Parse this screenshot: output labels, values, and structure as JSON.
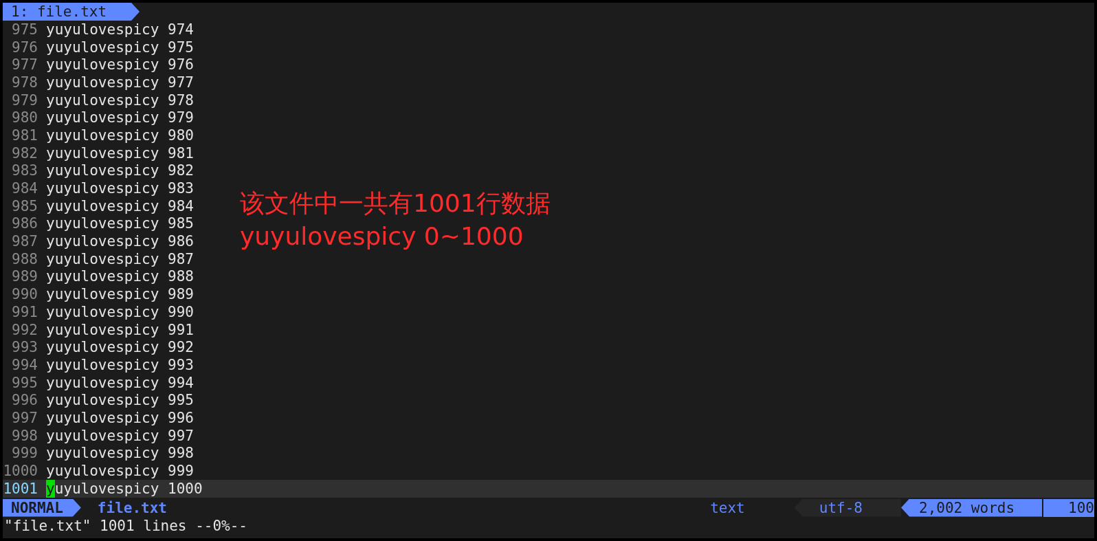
{
  "tabline": {
    "tabs": [
      {
        "label": "1: file.txt",
        "selected": true
      }
    ]
  },
  "lines": [
    {
      "number": "975",
      "text": "yuyulovespicy 974",
      "current": false
    },
    {
      "number": "976",
      "text": "yuyulovespicy 975",
      "current": false
    },
    {
      "number": "977",
      "text": "yuyulovespicy 976",
      "current": false
    },
    {
      "number": "978",
      "text": "yuyulovespicy 977",
      "current": false
    },
    {
      "number": "979",
      "text": "yuyulovespicy 978",
      "current": false
    },
    {
      "number": "980",
      "text": "yuyulovespicy 979",
      "current": false
    },
    {
      "number": "981",
      "text": "yuyulovespicy 980",
      "current": false
    },
    {
      "number": "982",
      "text": "yuyulovespicy 981",
      "current": false
    },
    {
      "number": "983",
      "text": "yuyulovespicy 982",
      "current": false
    },
    {
      "number": "984",
      "text": "yuyulovespicy 983",
      "current": false
    },
    {
      "number": "985",
      "text": "yuyulovespicy 984",
      "current": false
    },
    {
      "number": "986",
      "text": "yuyulovespicy 985",
      "current": false
    },
    {
      "number": "987",
      "text": "yuyulovespicy 986",
      "current": false
    },
    {
      "number": "988",
      "text": "yuyulovespicy 987",
      "current": false
    },
    {
      "number": "989",
      "text": "yuyulovespicy 988",
      "current": false
    },
    {
      "number": "990",
      "text": "yuyulovespicy 989",
      "current": false
    },
    {
      "number": "991",
      "text": "yuyulovespicy 990",
      "current": false
    },
    {
      "number": "992",
      "text": "yuyulovespicy 991",
      "current": false
    },
    {
      "number": "993",
      "text": "yuyulovespicy 992",
      "current": false
    },
    {
      "number": "994",
      "text": "yuyulovespicy 993",
      "current": false
    },
    {
      "number": "995",
      "text": "yuyulovespicy 994",
      "current": false
    },
    {
      "number": "996",
      "text": "yuyulovespicy 995",
      "current": false
    },
    {
      "number": "997",
      "text": "yuyulovespicy 996",
      "current": false
    },
    {
      "number": "998",
      "text": "yuyulovespicy 997",
      "current": false
    },
    {
      "number": "999",
      "text": "yuyulovespicy 998",
      "current": false
    },
    {
      "number": "1000",
      "text": "yuyulovespicy 999",
      "current": false
    },
    {
      "number": "1001",
      "text": "yuyulovespicy 1000",
      "current": true
    }
  ],
  "annotation": [
    "该文件中一共有1001行数据",
    "yuyulovespicy 0~1000"
  ],
  "status_line": {
    "mode": "NORMAL",
    "filename": "file.txt",
    "filetype": "text",
    "encoding": "utf-8",
    "word_count": "2,002 words",
    "percent": "100"
  },
  "command_line": "\"file.txt\" 1001 lines --0%--"
}
